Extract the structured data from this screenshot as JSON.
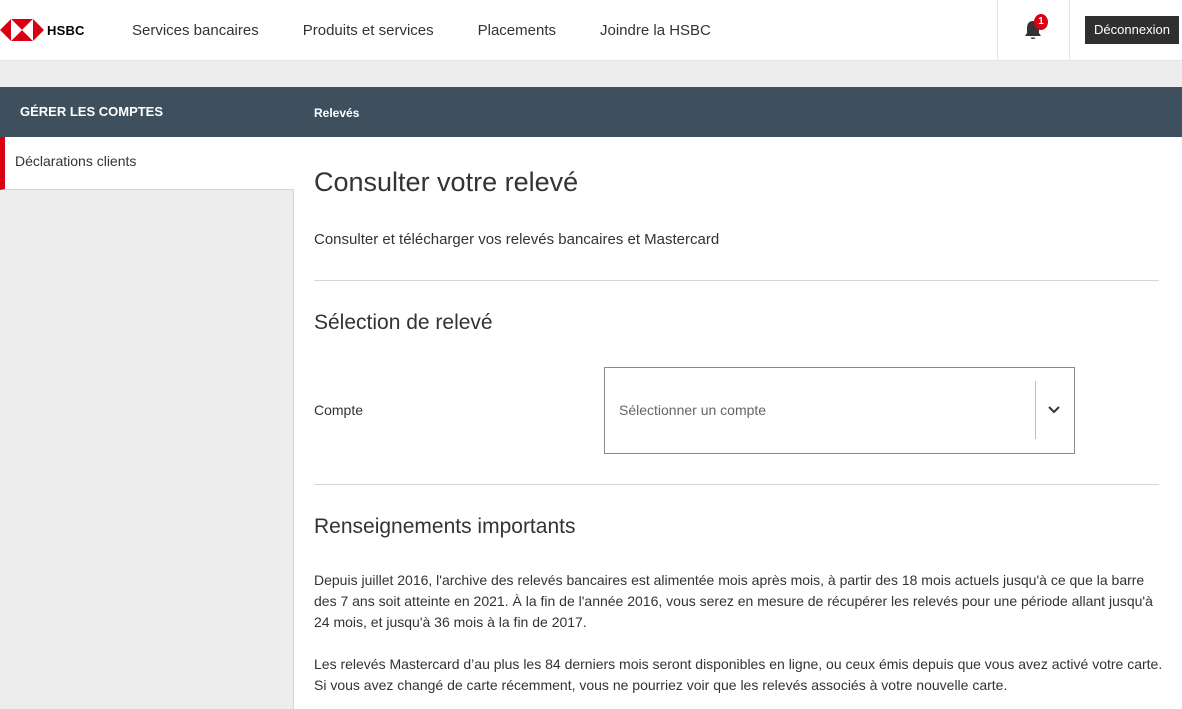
{
  "brand": {
    "name": "HSBC"
  },
  "nav": {
    "items": [
      "Services bancaires",
      "Produits et services",
      "Placements",
      "Joindre la HSBC"
    ],
    "notifications_count": "1",
    "logout_label": "Déconnexion"
  },
  "band": {
    "left_title": "GÉRER LES COMPTES",
    "right_title": "Relevés"
  },
  "sidebar": {
    "items": [
      {
        "label": "Déclarations clients",
        "active": true
      }
    ]
  },
  "main": {
    "title": "Consulter votre relevé",
    "subtitle": "Consulter et télécharger vos relevés bancaires et Mastercard",
    "selection_heading": "Sélection de relevé",
    "account_label": "Compte",
    "account_placeholder": "Sélectionner un compte",
    "info_heading": "Renseignements importants",
    "paragraphs": [
      "Depuis juillet 2016, l'archive des relevés bancaires est alimentée mois après mois, à partir des 18 mois actuels jusqu'à ce que la barre des 7 ans soit atteinte en 2021. À la fin de l'année 2016, vous serez en mesure de récupérer les relevés pour une période allant jusqu'à 24 mois, et jusqu'à 36 mois à la fin de 2017.",
      "Les relevés Mastercard d’au plus les 84 derniers mois seront disponibles en ligne, ou ceux émis depuis que vous avez activé votre carte. Si vous avez changé de carte récemment, vous ne pourriez voir que les relevés associés à votre nouvelle carte."
    ]
  },
  "colors": {
    "brand_red": "#db0011",
    "band": "#3e505d",
    "logout_bg": "#2f2f2f"
  },
  "icons": {
    "logo": "hsbc-hexagon-logo",
    "notifications": "bell-icon",
    "dropdown": "chevron-down-icon"
  }
}
